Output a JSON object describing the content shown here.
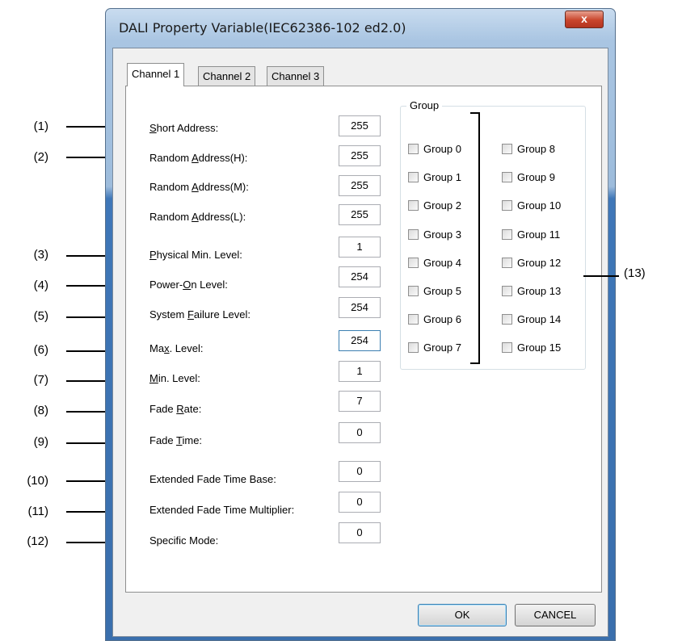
{
  "window": {
    "title": "DALI Property Variable(IEC62386-102 ed2.0)",
    "close_label": "x"
  },
  "tabs": [
    "Channel 1",
    "Channel 2",
    "Channel 3"
  ],
  "fields": [
    {
      "label": "Short Address:",
      "value": "255",
      "anno": "(1)"
    },
    {
      "label": "Random Address(H):",
      "value": "255",
      "anno": "(2)"
    },
    {
      "label": "Random Address(M):",
      "value": "255",
      "anno": ""
    },
    {
      "label": "Random Address(L):",
      "value": "255",
      "anno": ""
    },
    {
      "label": "Physical Min. Level:",
      "value": "1",
      "anno": "(3)"
    },
    {
      "label": "Power-On Level:",
      "value": "254",
      "anno": "(4)"
    },
    {
      "label": "System Failure Level:",
      "value": "254",
      "anno": "(5)"
    },
    {
      "label": "Max. Level:",
      "value": "254",
      "anno": "(6)"
    },
    {
      "label": "Min. Level:",
      "value": "1",
      "anno": "(7)"
    },
    {
      "label": "Fade Rate:",
      "value": "7",
      "anno": "(8)"
    },
    {
      "label": "Fade Time:",
      "value": "0",
      "anno": "(9)"
    },
    {
      "label": "Extended Fade Time Base:",
      "value": "0",
      "anno": "(10)"
    },
    {
      "label": "Extended Fade Time Multiplier:",
      "value": "0",
      "anno": "(11)"
    },
    {
      "label": "Specific Mode:",
      "value": "0",
      "anno": "(12)"
    }
  ],
  "group": {
    "legend": "Group",
    "items": [
      "Group 0",
      "Group 1",
      "Group 2",
      "Group 3",
      "Group 4",
      "Group 5",
      "Group 6",
      "Group 7",
      "Group 8",
      "Group 9",
      "Group 10",
      "Group 11",
      "Group 12",
      "Group 13",
      "Group 14",
      "Group 15"
    ],
    "anno": "(13)"
  },
  "buttons": {
    "ok": "OK",
    "cancel": "CANCEL"
  }
}
